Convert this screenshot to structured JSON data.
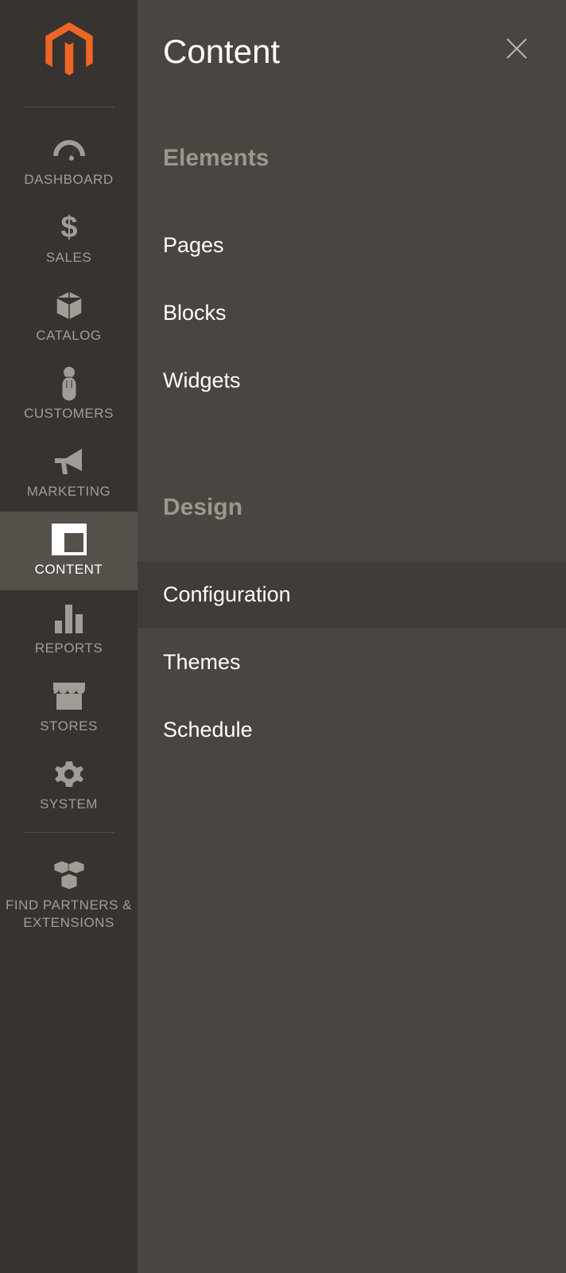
{
  "sidebar": {
    "items": [
      {
        "label": "DASHBOARD",
        "icon": "dashboard-icon"
      },
      {
        "label": "SALES",
        "icon": "dollar-icon"
      },
      {
        "label": "CATALOG",
        "icon": "box-icon"
      },
      {
        "label": "CUSTOMERS",
        "icon": "person-icon"
      },
      {
        "label": "MARKETING",
        "icon": "megaphone-icon"
      },
      {
        "label": "CONTENT",
        "icon": "content-icon",
        "active": true
      },
      {
        "label": "REPORTS",
        "icon": "bars-icon"
      },
      {
        "label": "STORES",
        "icon": "store-icon"
      },
      {
        "label": "SYSTEM",
        "icon": "gear-icon"
      },
      {
        "label": "FIND PARTNERS & EXTENSIONS",
        "icon": "blocks-icon"
      }
    ]
  },
  "submenu": {
    "title": "Content",
    "groups": [
      {
        "heading": "Elements",
        "items": [
          {
            "label": "Pages"
          },
          {
            "label": "Blocks"
          },
          {
            "label": "Widgets"
          }
        ]
      },
      {
        "heading": "Design",
        "items": [
          {
            "label": "Configuration",
            "active": true
          },
          {
            "label": "Themes"
          },
          {
            "label": "Schedule"
          }
        ]
      }
    ]
  }
}
